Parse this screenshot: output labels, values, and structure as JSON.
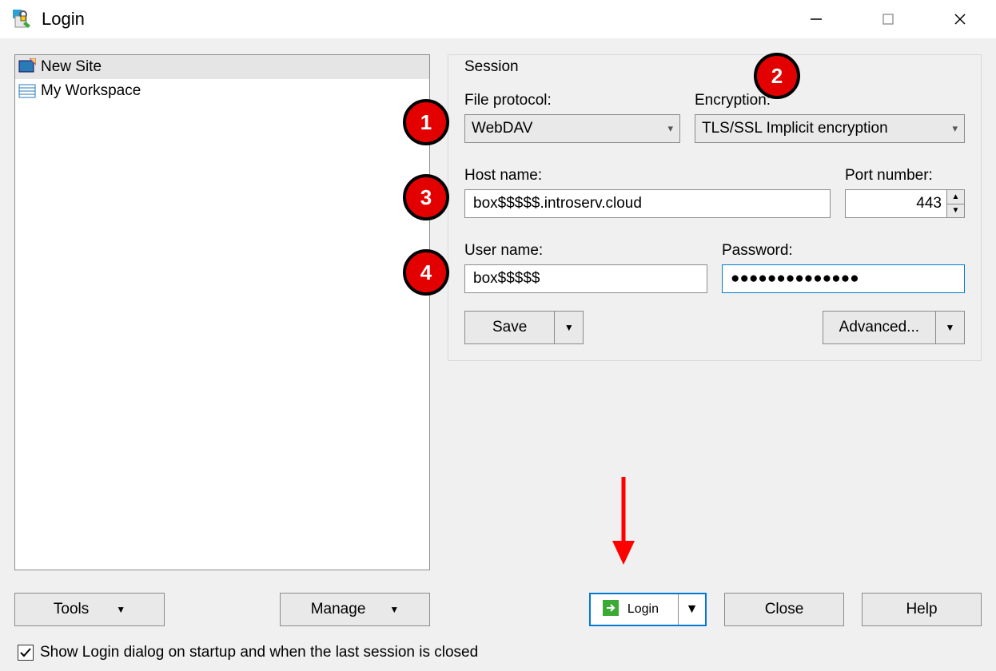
{
  "window": {
    "title": "Login"
  },
  "sites": {
    "items": [
      {
        "label": "New Site",
        "selected": true
      },
      {
        "label": "My Workspace",
        "selected": false
      }
    ]
  },
  "session": {
    "legend": "Session",
    "file_protocol_label": "File protocol:",
    "file_protocol_value": "WebDAV",
    "encryption_label": "Encryption:",
    "encryption_value": "TLS/SSL Implicit encryption",
    "host_label": "Host name:",
    "host_value": "box$$$$$.introserv.cloud",
    "port_label": "Port number:",
    "port_value": "443",
    "user_label": "User name:",
    "user_value": "box$$$$$",
    "password_label": "Password:",
    "password_value": "●●●●●●●●●●●●●●",
    "save_label": "Save",
    "advanced_label": "Advanced..."
  },
  "buttons": {
    "tools": "Tools",
    "manage": "Manage",
    "login": "Login",
    "close": "Close",
    "help": "Help"
  },
  "footer": {
    "checkbox_label": "Show Login dialog on startup and when the last session is closed",
    "checked": true
  },
  "annotations": {
    "b1": "1",
    "b2": "2",
    "b3": "3",
    "b4": "4"
  }
}
